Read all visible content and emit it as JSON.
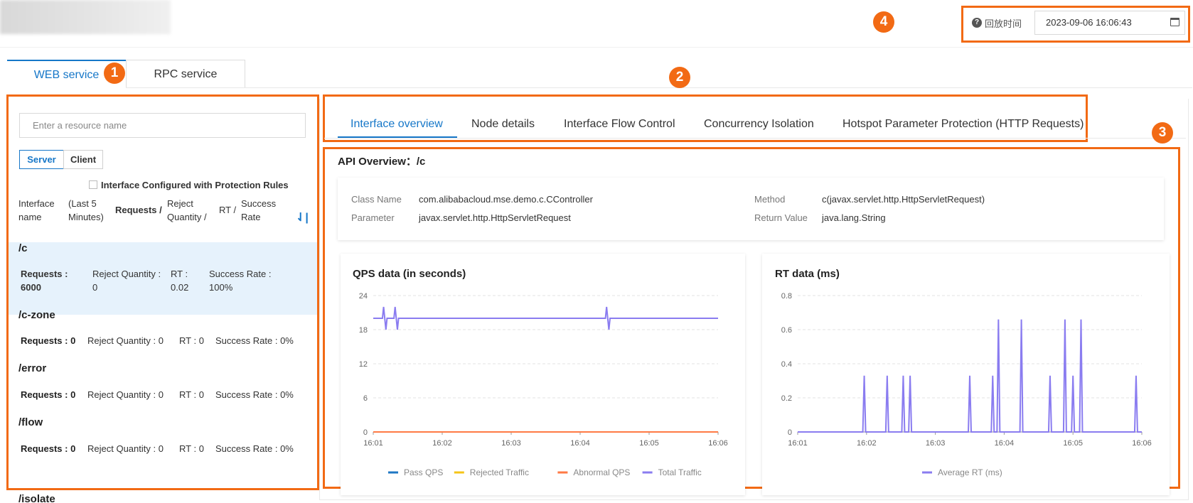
{
  "header": {
    "time_label": "回放时间",
    "time_value": "2023-09-06 16:06:43"
  },
  "badges": [
    "1",
    "2",
    "3",
    "4"
  ],
  "service_tabs": [
    {
      "label": "WEB service",
      "active": true
    },
    {
      "label": "RPC service",
      "active": false
    }
  ],
  "left_panel": {
    "search_placeholder": "Enter a resource name",
    "segments": [
      "Server",
      "Client"
    ],
    "checkbox_label": "Interface Configured with Protection Rules",
    "columns": {
      "name_1": "Interface",
      "name_2": "name",
      "period_1": "(Last 5",
      "period_2": "Minutes)",
      "requests": "Requests /",
      "reject_1": "Reject",
      "reject_2": "Quantity /",
      "rt": "RT /",
      "success_1": "Success",
      "success_2": "Rate"
    },
    "items": [
      {
        "name": "/c",
        "requests_label": "Requests :",
        "requests": "6000",
        "reject_label": "Reject Quantity :",
        "reject": "0",
        "rt_label": "RT :",
        "rt": "0.02",
        "success_label": "Success Rate :",
        "success": "100%"
      },
      {
        "name": "/c-zone",
        "requests_label": "Requests :",
        "requests": "0",
        "reject_label": "Reject Quantity :",
        "reject": "0",
        "rt_label": "RT :",
        "rt": "0",
        "success_label": "Success Rate :",
        "success": "0%"
      },
      {
        "name": "/error",
        "requests_label": "Requests :",
        "requests": "0",
        "reject_label": "Reject Quantity :",
        "reject": "0",
        "rt_label": "RT :",
        "rt": "0",
        "success_label": "Success Rate :",
        "success": "0%"
      },
      {
        "name": "/flow",
        "requests_label": "Requests :",
        "requests": "0",
        "reject_label": "Reject Quantity :",
        "reject": "0",
        "rt_label": "RT :",
        "rt": "0",
        "success_label": "Success Rate :",
        "success": "0%"
      },
      {
        "name": "/isolate"
      }
    ]
  },
  "content_tabs": [
    "Interface overview",
    "Node details",
    "Interface Flow Control",
    "Concurrency Isolation",
    "Hotspot Parameter Protection (HTTP Requests)"
  ],
  "overview": {
    "title": "API Overview：/c",
    "class_name_label": "Class Name",
    "class_name": "com.alibabacloud.mse.demo.c.CController",
    "method_label": "Method",
    "method": "c(javax.servlet.http.HttpServletRequest)",
    "parameter_label": "Parameter",
    "parameter": "javax.servlet.http.HttpServletRequest",
    "return_label": "Return Value",
    "return_value": "java.lang.String"
  },
  "chart_data": [
    {
      "type": "line",
      "title": "QPS data (in seconds)",
      "x_ticks": [
        "16:01",
        "16:02",
        "16:03",
        "16:04",
        "16:05",
        "16:06"
      ],
      "y_ticks": [
        "0",
        "6",
        "12",
        "18",
        "24"
      ],
      "ylim": [
        0,
        24
      ],
      "grid": true,
      "legend_position": "bottom",
      "series": [
        {
          "name": "Pass QPS",
          "color": "#1f77c4",
          "points": [
            [
              "16:01",
              0
            ],
            [
              "16:06",
              0
            ]
          ]
        },
        {
          "name": "Rejected Traffic",
          "color": "#f5c518",
          "points": [
            [
              "16:01",
              0
            ],
            [
              "16:06",
              0
            ]
          ]
        },
        {
          "name": "Abnormal QPS",
          "color": "#ff7a45",
          "points": [
            [
              "16:01",
              0
            ],
            [
              "16:06",
              0
            ]
          ]
        },
        {
          "name": "Total Traffic",
          "color": "#8a7cf0",
          "points": [
            [
              "16:01",
              20
            ],
            [
              "16:01:08",
              20
            ],
            [
              "16:01:09",
              22
            ],
            [
              "16:01:10",
              20
            ],
            [
              "16:01:11",
              18
            ],
            [
              "16:01:12",
              20
            ],
            [
              "16:01:18",
              20
            ],
            [
              "16:01:19",
              22
            ],
            [
              "16:01:20",
              20
            ],
            [
              "16:01:21",
              18
            ],
            [
              "16:01:22",
              20
            ],
            [
              "16:04:22",
              20
            ],
            [
              "16:04:23",
              22
            ],
            [
              "16:04:24",
              20
            ],
            [
              "16:04:25",
              18
            ],
            [
              "16:04:26",
              20
            ],
            [
              "16:06",
              20
            ]
          ]
        }
      ]
    },
    {
      "type": "line",
      "title": "RT data (ms)",
      "x_ticks": [
        "16:01",
        "16:02",
        "16:03",
        "16:04",
        "16:05",
        "16:06"
      ],
      "y_ticks": [
        "0",
        "0.2",
        "0.4",
        "0.6",
        "0.8"
      ],
      "ylim": [
        0,
        0.8
      ],
      "grid": true,
      "legend_position": "bottom",
      "series": [
        {
          "name": "Average RT (ms)",
          "color": "#8a7cf0",
          "spikes": [
            [
              "16:01:58",
              0.33
            ],
            [
              "16:02:18",
              0.33
            ],
            [
              "16:02:32",
              0.33
            ],
            [
              "16:02:38",
              0.33
            ],
            [
              "16:03:30",
              0.33
            ],
            [
              "16:03:50",
              0.33
            ],
            [
              "16:03:55",
              0.66
            ],
            [
              "16:04:15",
              0.66
            ],
            [
              "16:04:40",
              0.33
            ],
            [
              "16:04:53",
              0.66
            ],
            [
              "16:05:00",
              0.33
            ],
            [
              "16:05:07",
              0.66
            ],
            [
              "16:05:55",
              0.33
            ]
          ]
        }
      ]
    }
  ]
}
